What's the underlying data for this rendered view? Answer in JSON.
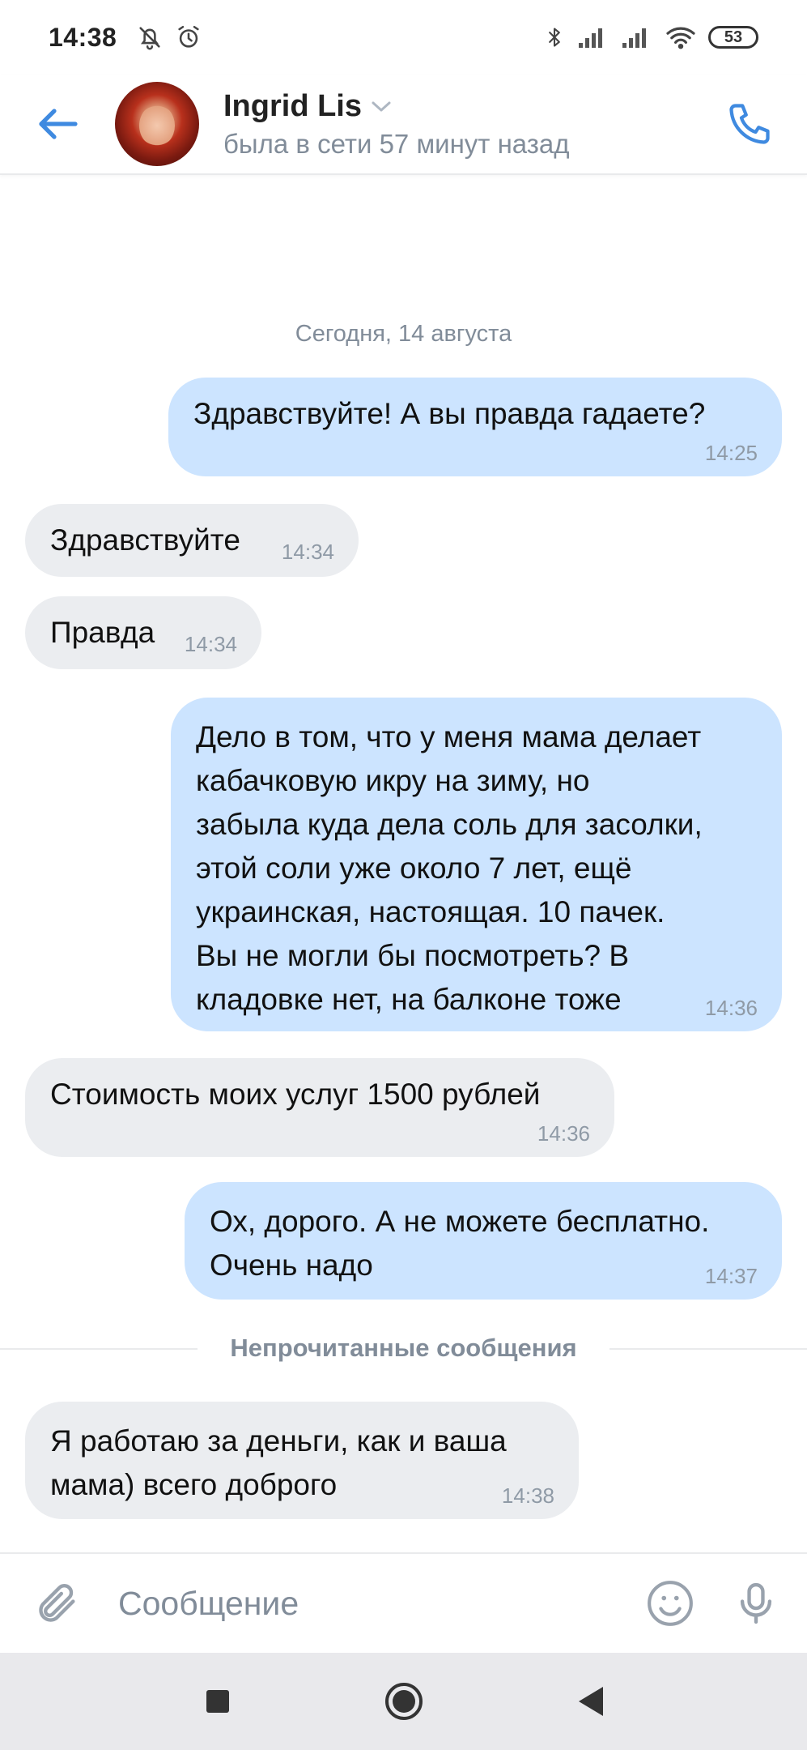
{
  "status_bar": {
    "time": "14:38",
    "battery": "53"
  },
  "header": {
    "contact_name": "Ingrid Lis",
    "contact_status": "была в сети 57 минут назад"
  },
  "chat": {
    "date_separator": "Сегодня, 14 августа",
    "messages": [
      {
        "direction": "out",
        "text": "Здравствуйте! А вы правда гадаете?",
        "time": "14:25"
      },
      {
        "direction": "in",
        "text": "Здравствуйте",
        "time": "14:34"
      },
      {
        "direction": "in",
        "text": "Правда",
        "time": "14:34"
      },
      {
        "direction": "out",
        "text": "Дело в том, что у меня мама делает\nкабачковую икру на зиму, но\nзабыла куда дела соль для засолки,\nэтой соли уже около 7 лет, ещё\nукраинская, настоящая. 10 пачек.\nВы не могли бы посмотреть? В\nкладовке нет, на балконе тоже",
        "time": "14:36"
      },
      {
        "direction": "in",
        "text": "Стоимость моих услуг 1500 рублей",
        "time": "14:36"
      },
      {
        "direction": "out",
        "text": "Ох, дорого. А не можете бесплатно.\nОчень надо",
        "time": "14:37"
      },
      {
        "direction": "in",
        "text": "Я работаю за деньги, как и ваша\nмама) всего доброго",
        "time": "14:38"
      }
    ],
    "unread_label": "Непрочитанные сообщения"
  },
  "composer": {
    "placeholder": "Сообщение"
  },
  "colors": {
    "accent": "#3f8ae0",
    "outgoing_bubble": "#cce4ff",
    "incoming_bubble": "#ebedf0",
    "secondary_text": "#818c99"
  },
  "icons": {
    "status": [
      "muted-bell-icon",
      "alarm-icon",
      "bluetooth-icon",
      "signal-icon",
      "signal-icon",
      "wifi-icon",
      "battery-icon"
    ],
    "header": [
      "arrow-left-icon",
      "chevron-down-icon",
      "phone-icon"
    ],
    "composer": [
      "paperclip-icon",
      "smile-icon",
      "microphone-icon"
    ],
    "navigation": [
      "square-recents-icon",
      "circle-home-icon",
      "triangle-back-icon"
    ]
  }
}
